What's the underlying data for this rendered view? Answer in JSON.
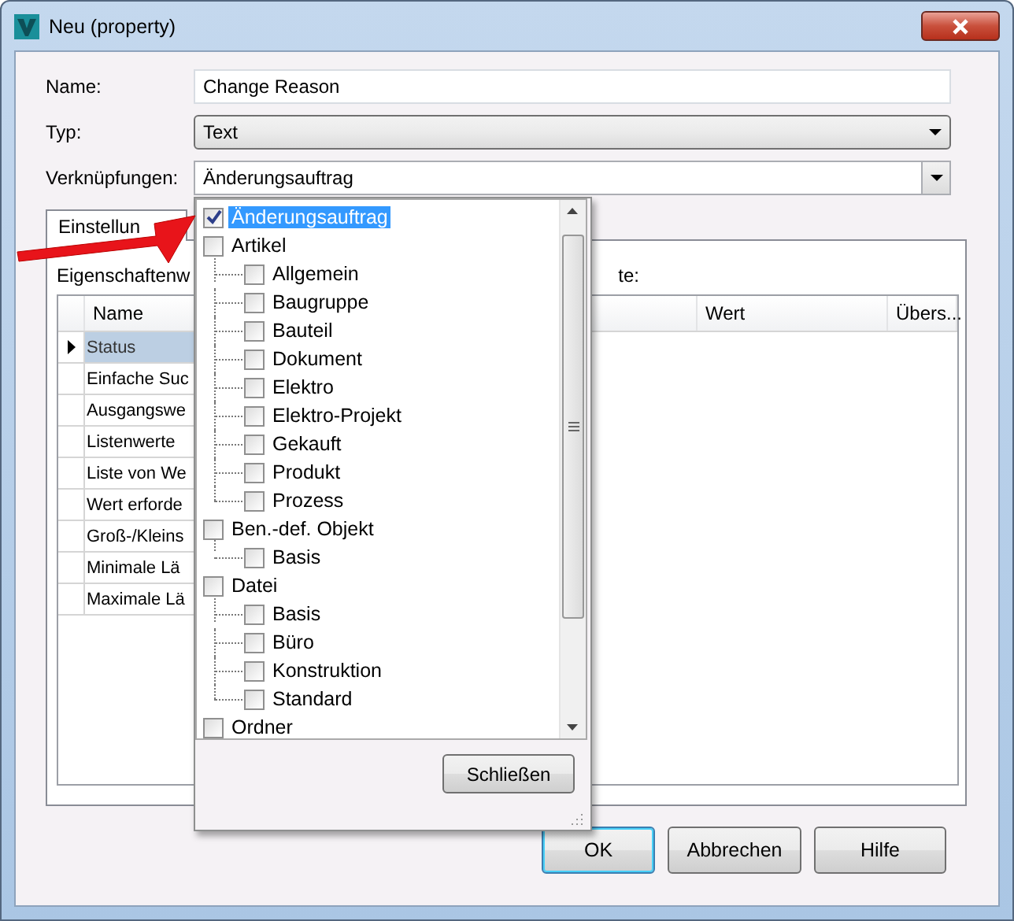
{
  "window": {
    "title": "Neu (property)"
  },
  "form": [
    {
      "label": "Name:",
      "kind": "text",
      "value": "Change Reason"
    },
    {
      "label": "Typ:",
      "kind": "select",
      "value": "Text"
    },
    {
      "label": "Verknüpfungen:",
      "kind": "combo",
      "value": "Änderungsauftrag"
    }
  ],
  "tabs": [
    {
      "label": "Einstellun",
      "selected": true
    }
  ],
  "panel": {
    "label": "Eigenschaftenw",
    "label_tail": "te:",
    "columns": [
      "Name",
      "Wert",
      "Übers..."
    ],
    "rows": [
      {
        "name": "Status",
        "selected": true
      },
      {
        "name": "Einfache Suc",
        "selected": false
      },
      {
        "name": "Ausgangswe",
        "selected": false
      },
      {
        "name": "Listenwerte",
        "selected": false
      },
      {
        "name": "Liste von We",
        "selected": false
      },
      {
        "name": "Wert erforde",
        "selected": false
      },
      {
        "name": "Groß-/Kleins",
        "selected": false
      },
      {
        "name": "Minimale Lä",
        "selected": false
      },
      {
        "name": "Maximale Lä",
        "selected": false
      }
    ]
  },
  "dropdown": {
    "tree": [
      {
        "label": "Änderungsauftrag",
        "checked": true,
        "selected": true
      },
      {
        "label": "Artikel",
        "checked": false,
        "selected": false,
        "children": [
          {
            "label": "Allgemein",
            "checked": false,
            "selected": false
          },
          {
            "label": "Baugruppe",
            "checked": false,
            "selected": false
          },
          {
            "label": "Bauteil",
            "checked": false,
            "selected": false
          },
          {
            "label": "Dokument",
            "checked": false,
            "selected": false
          },
          {
            "label": "Elektro",
            "checked": false,
            "selected": false
          },
          {
            "label": "Elektro-Projekt",
            "checked": false,
            "selected": false
          },
          {
            "label": "Gekauft",
            "checked": false,
            "selected": false
          },
          {
            "label": "Produkt",
            "checked": false,
            "selected": false
          },
          {
            "label": "Prozess",
            "checked": false,
            "selected": false
          }
        ]
      },
      {
        "label": "Ben.-def. Objekt",
        "checked": false,
        "selected": false,
        "children": [
          {
            "label": "Basis",
            "checked": false,
            "selected": false
          }
        ]
      },
      {
        "label": "Datei",
        "checked": false,
        "selected": false,
        "children": [
          {
            "label": "Basis",
            "checked": false,
            "selected": false
          },
          {
            "label": "Büro",
            "checked": false,
            "selected": false
          },
          {
            "label": "Konstruktion",
            "checked": false,
            "selected": false
          },
          {
            "label": "Standard",
            "checked": false,
            "selected": false
          }
        ]
      },
      {
        "label": "Ordner",
        "checked": false,
        "selected": false
      }
    ],
    "close_button": "Schließen"
  },
  "buttons": [
    {
      "label": "OK",
      "kind": "default"
    },
    {
      "label": "Abbrechen",
      "kind": "normal"
    },
    {
      "label": "Hilfe",
      "kind": "normal"
    }
  ]
}
